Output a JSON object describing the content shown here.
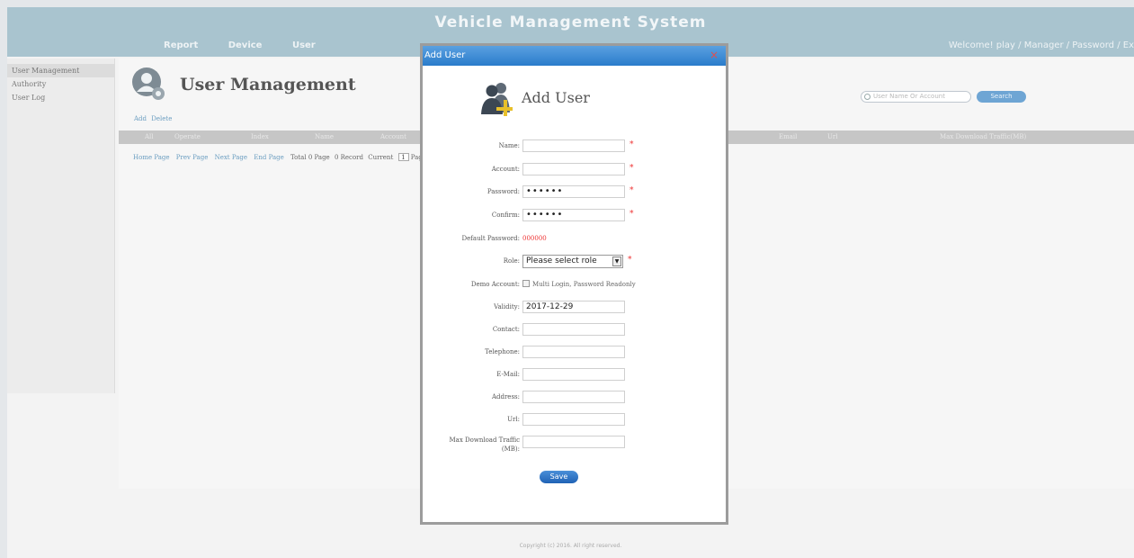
{
  "header": {
    "title": "Vehicle Management System",
    "nav": [
      "Report",
      "Device",
      "User"
    ],
    "welcome": "Welcome! play",
    "role": "Manager",
    "password": "Password",
    "exit": "Ex"
  },
  "sidebar": {
    "items": [
      {
        "label": "User Management"
      },
      {
        "label": "Authority"
      },
      {
        "label": "User Log"
      }
    ]
  },
  "main": {
    "title": "User Management",
    "actions": {
      "add": "Add",
      "delete": "Delete"
    },
    "search_placeholder": "User Name Or Account",
    "search_button": "Search",
    "columns": [
      "All",
      "Operate",
      "Index",
      "Name",
      "Account",
      "Email",
      "Url",
      "Max Download Traffic(MB)"
    ],
    "pager": {
      "home": "Home Page",
      "prev": "Prev Page",
      "next": "Next Page",
      "end": "End Page",
      "total_pages": "Total 0 Page",
      "records": "0 Record",
      "current": "Current",
      "current_value": "1",
      "page": "Page"
    }
  },
  "footer": {
    "copyright": "Copyright (c) 2016. All right reserved."
  },
  "modal": {
    "titlebar": "Add User",
    "close": "×",
    "heading": "Add User",
    "fields": {
      "name": {
        "label": "Name:",
        "value": ""
      },
      "account": {
        "label": "Account:",
        "value": ""
      },
      "password": {
        "label": "Password:",
        "value": "••••••"
      },
      "confirm": {
        "label": "Confirm:",
        "value": "••••••"
      },
      "default_password": {
        "label": "Default Password:",
        "value": "000000"
      },
      "role": {
        "label": "Role:",
        "value": "Please select role"
      },
      "demo_account": {
        "label": "Demo Account:",
        "option": "Multi Login, Password Readonly"
      },
      "validity": {
        "label": "Validity:",
        "value": "2017-12-29"
      },
      "contact": {
        "label": "Contact:",
        "value": ""
      },
      "telephone": {
        "label": "Telephone:",
        "value": ""
      },
      "email": {
        "label": "E-Mail:",
        "value": ""
      },
      "address": {
        "label": "Address:",
        "value": ""
      },
      "url": {
        "label": "Url:",
        "value": ""
      },
      "max_download_line1": "Max Download Traffic",
      "max_download_line2": "(MB):",
      "max_download_value": ""
    },
    "required_mark": "*",
    "save": "Save"
  },
  "colors": {
    "header_bg": "#a9c4cf",
    "titlebar_blue": "#2a7ccb",
    "required_red": "#e33333",
    "link_blue": "#6a9dc0"
  }
}
